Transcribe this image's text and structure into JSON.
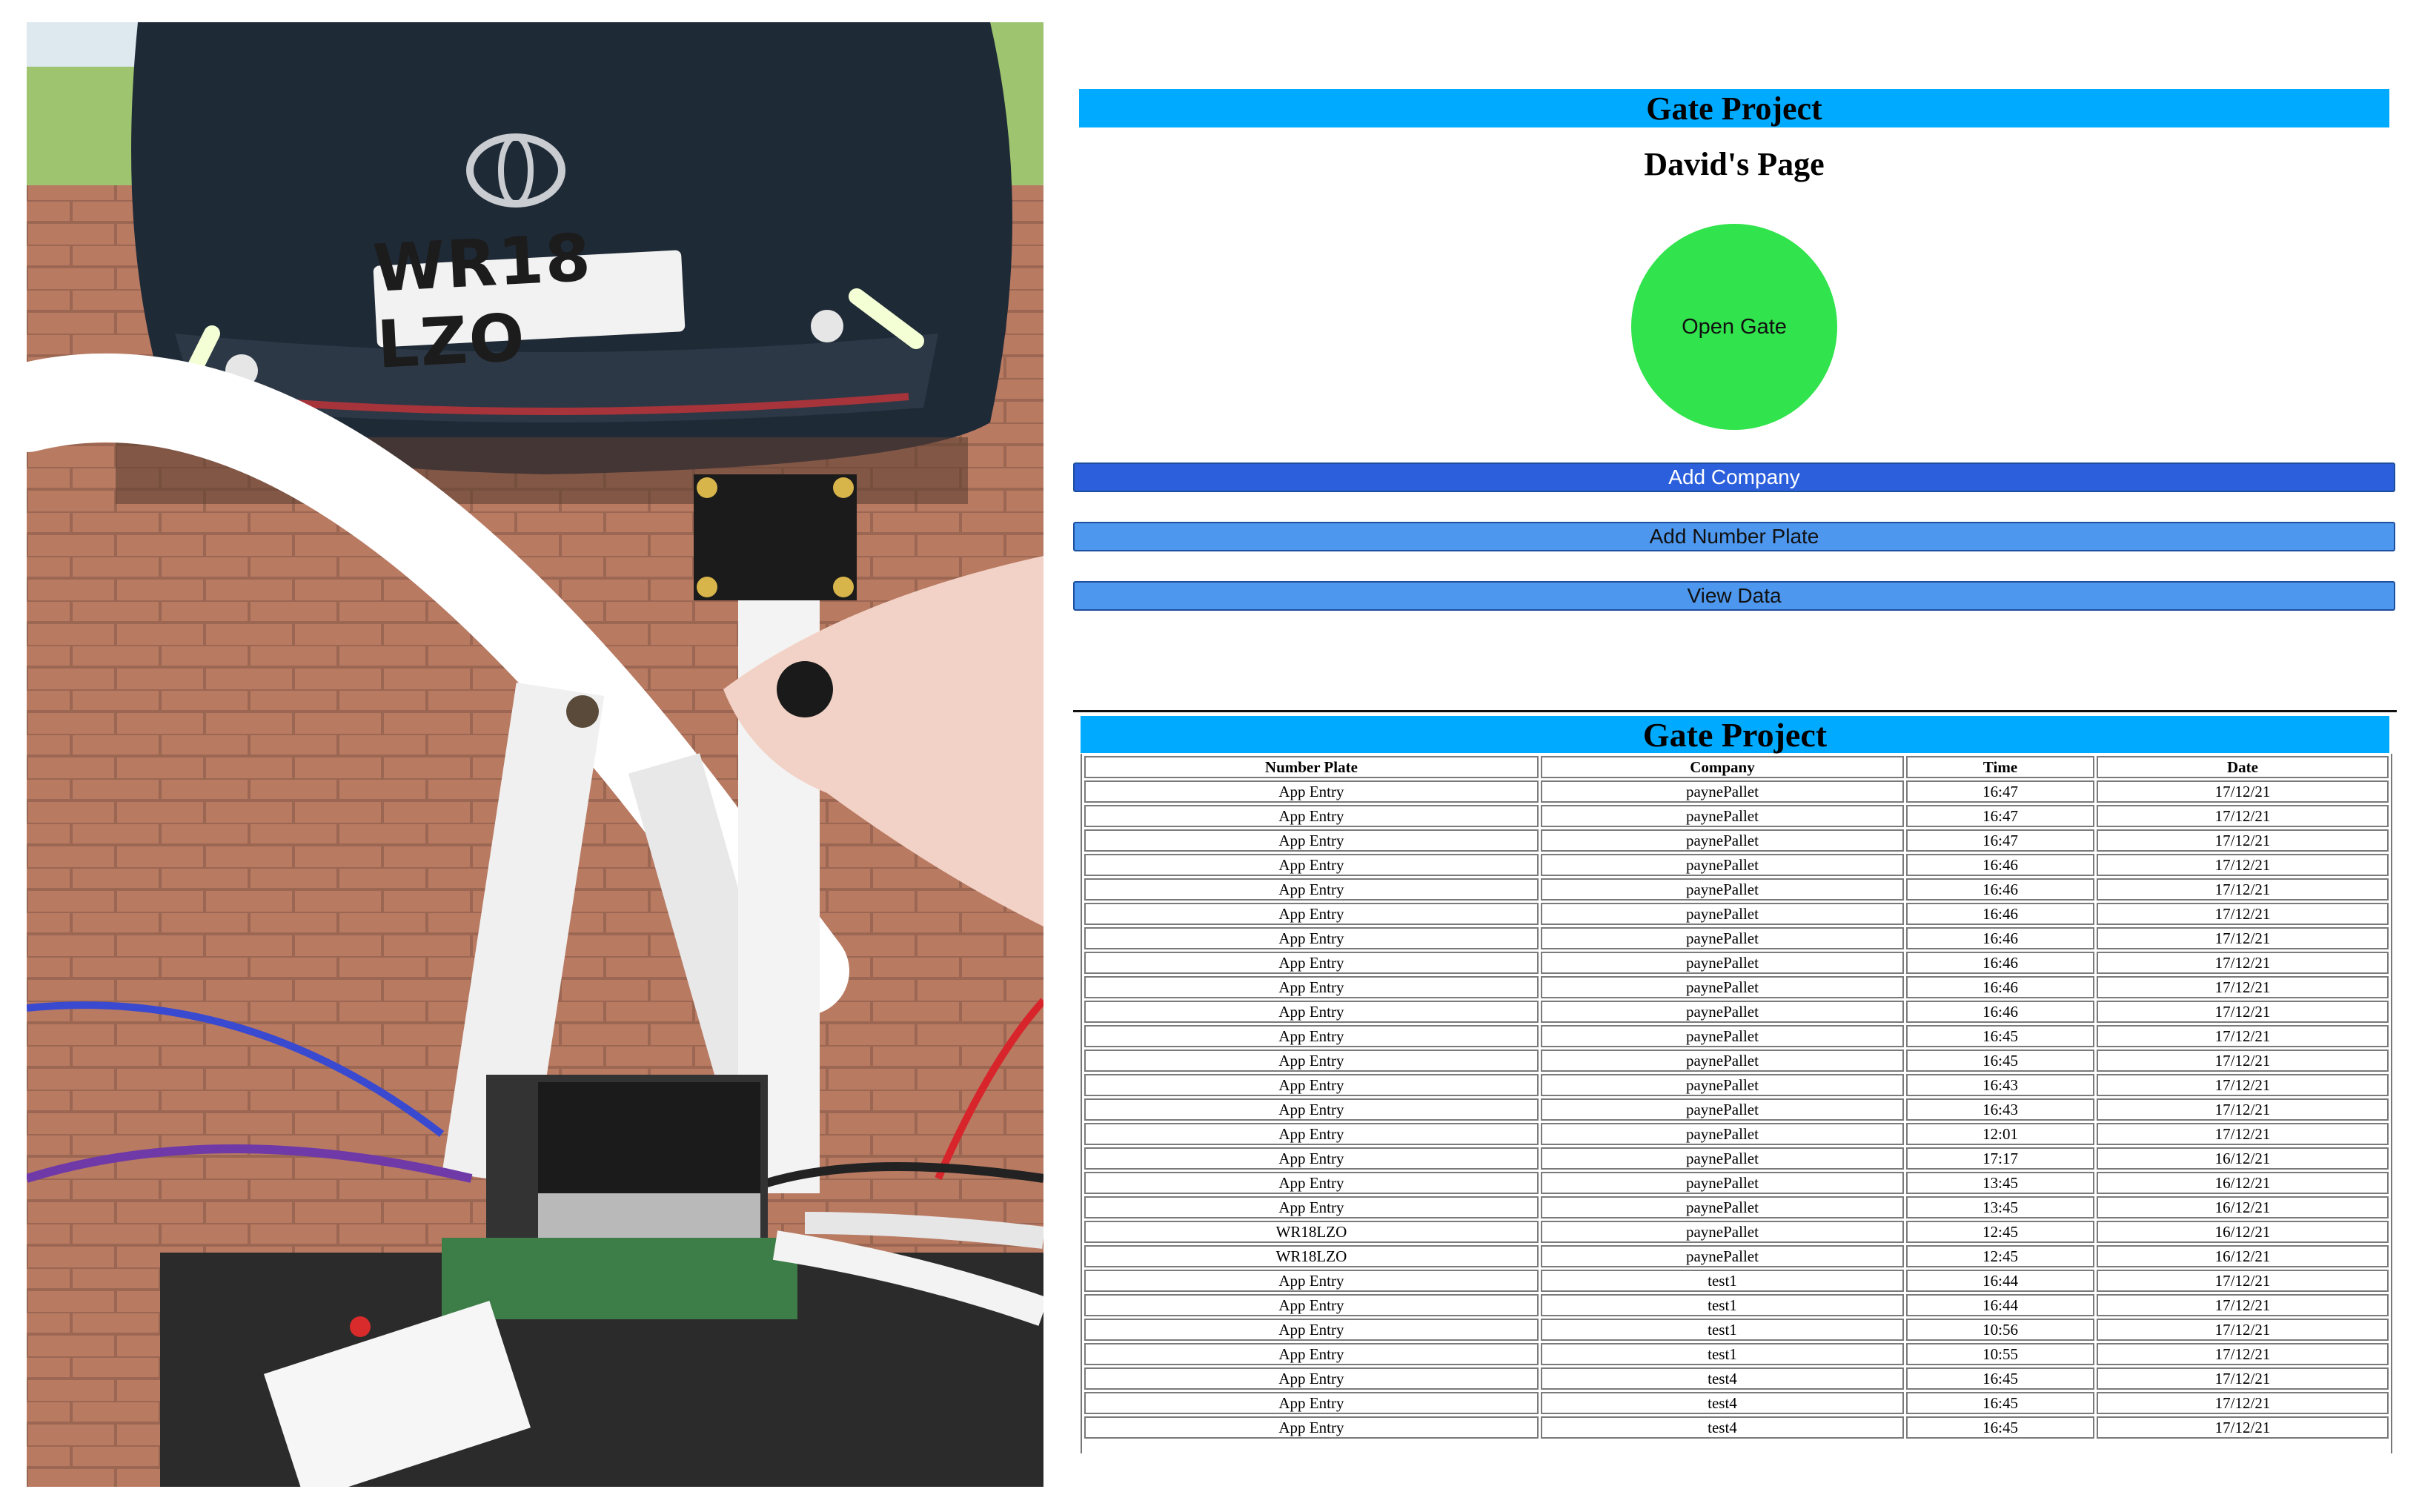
{
  "photo": {
    "description_icon": "photo-icon",
    "license_plate": "WR18 LZO"
  },
  "page": {
    "header_title": "Gate Project",
    "subtitle": "David's Page",
    "open_gate_label": "Open Gate",
    "add_company_label": "Add Company",
    "add_number_plate_label": "Add Number Plate",
    "view_data_label": "View Data",
    "colors": {
      "header": "#00aaff",
      "open_gate": "#31e34c",
      "add_company": "#2c5fdc",
      "secondary_button": "#4d97ee"
    }
  },
  "table": {
    "title": "Gate Project",
    "columns": [
      "Number Plate",
      "Company",
      "Time",
      "Date"
    ],
    "rows": [
      [
        "App Entry",
        "paynePallet",
        "16:47",
        "17/12/21"
      ],
      [
        "App Entry",
        "paynePallet",
        "16:47",
        "17/12/21"
      ],
      [
        "App Entry",
        "paynePallet",
        "16:47",
        "17/12/21"
      ],
      [
        "App Entry",
        "paynePallet",
        "16:46",
        "17/12/21"
      ],
      [
        "App Entry",
        "paynePallet",
        "16:46",
        "17/12/21"
      ],
      [
        "App Entry",
        "paynePallet",
        "16:46",
        "17/12/21"
      ],
      [
        "App Entry",
        "paynePallet",
        "16:46",
        "17/12/21"
      ],
      [
        "App Entry",
        "paynePallet",
        "16:46",
        "17/12/21"
      ],
      [
        "App Entry",
        "paynePallet",
        "16:46",
        "17/12/21"
      ],
      [
        "App Entry",
        "paynePallet",
        "16:46",
        "17/12/21"
      ],
      [
        "App Entry",
        "paynePallet",
        "16:45",
        "17/12/21"
      ],
      [
        "App Entry",
        "paynePallet",
        "16:45",
        "17/12/21"
      ],
      [
        "App Entry",
        "paynePallet",
        "16:43",
        "17/12/21"
      ],
      [
        "App Entry",
        "paynePallet",
        "16:43",
        "17/12/21"
      ],
      [
        "App Entry",
        "paynePallet",
        "12:01",
        "17/12/21"
      ],
      [
        "App Entry",
        "paynePallet",
        "17:17",
        "16/12/21"
      ],
      [
        "App Entry",
        "paynePallet",
        "13:45",
        "16/12/21"
      ],
      [
        "App Entry",
        "paynePallet",
        "13:45",
        "16/12/21"
      ],
      [
        "WR18LZO",
        "paynePallet",
        "12:45",
        "16/12/21"
      ],
      [
        "WR18LZO",
        "paynePallet",
        "12:45",
        "16/12/21"
      ],
      [
        "App Entry",
        "test1",
        "16:44",
        "17/12/21"
      ],
      [
        "App Entry",
        "test1",
        "16:44",
        "17/12/21"
      ],
      [
        "App Entry",
        "test1",
        "10:56",
        "17/12/21"
      ],
      [
        "App Entry",
        "test1",
        "10:55",
        "17/12/21"
      ],
      [
        "App Entry",
        "test4",
        "16:45",
        "17/12/21"
      ],
      [
        "App Entry",
        "test4",
        "16:45",
        "17/12/21"
      ],
      [
        "App Entry",
        "test4",
        "16:45",
        "17/12/21"
      ]
    ]
  }
}
